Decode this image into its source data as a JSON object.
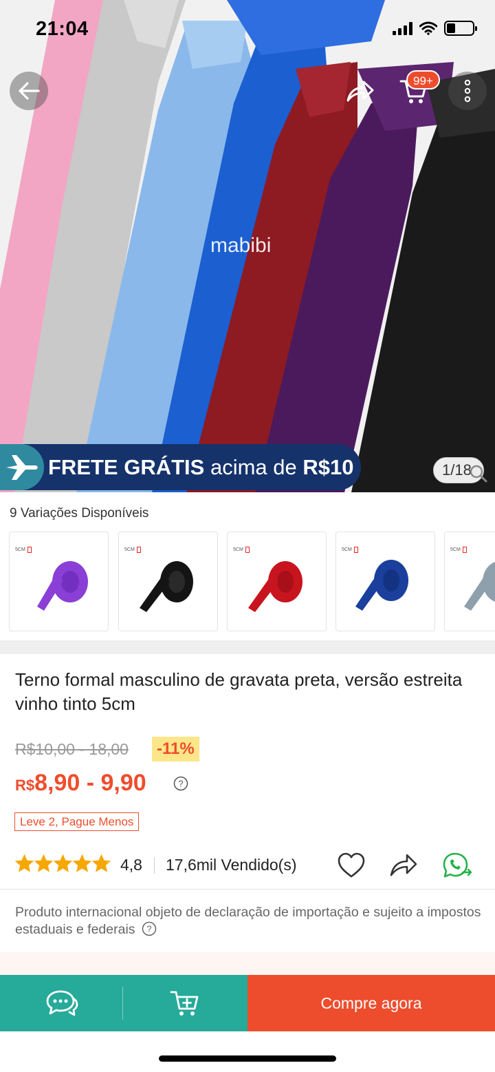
{
  "status_bar": {
    "time": "21:04",
    "signal_icon": "signal-icon",
    "wifi_icon": "wifi-icon",
    "battery_icon": "battery-icon"
  },
  "hero": {
    "watermark": "mabibi",
    "shipping_banner": {
      "bold": "FRETE GRÁTIS",
      "rest": " acima de ",
      "amount": "R$10"
    },
    "image_counter": "1/18",
    "cart_badge": "99+",
    "icons": [
      "back-arrow-icon",
      "share-icon",
      "cart-icon",
      "more-icon",
      "airplane-icon",
      "zoom-icon"
    ]
  },
  "variations": {
    "title": "9 Variações Disponíveis",
    "thumb_tag": "5CM",
    "items": [
      {
        "color": "#8a3fd6"
      },
      {
        "color": "#141414"
      },
      {
        "color": "#c8141e"
      },
      {
        "color": "#1a3f9c"
      },
      {
        "color": "#8fa0ad"
      }
    ]
  },
  "product": {
    "title": "Terno formal masculino de gravata preta, versão estreita vinho tinto 5cm",
    "old_price": "R$10,00 - 18,00",
    "discount": "-11%",
    "currency": "R$",
    "price": "8,90 - 9,90",
    "promo": "Leve 2, Pague Menos",
    "rating": "4,8",
    "rating_stars": 4.8,
    "sold": "17,6mil Vendido(s)",
    "import_note": "Produto internacional objeto de declaração de importação e sujeito a impostos estaduais e federais"
  },
  "bottom_bar": {
    "buy_label": "Compre agora",
    "chat_icon": "chat-icon",
    "add_cart_icon": "add-to-cart-icon"
  },
  "colors": {
    "accent": "#ee4d2d",
    "teal": "#26aa99",
    "banner": "#15326b",
    "discount_bg": "#fde68a",
    "star": "#f6a700"
  }
}
